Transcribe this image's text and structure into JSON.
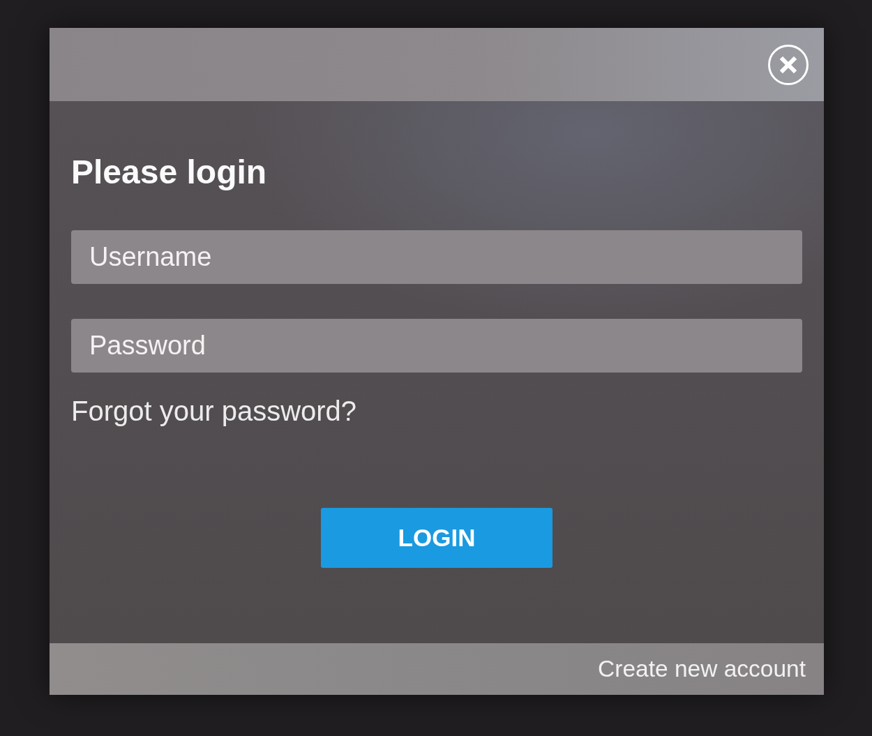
{
  "dialog": {
    "title": "Please login",
    "fields": [
      {
        "placeholder": "Username"
      },
      {
        "placeholder": "Password"
      }
    ],
    "forgot_link": "Forgot your password?",
    "submit_button": "LOGIN",
    "footer_link": "Create new account"
  }
}
